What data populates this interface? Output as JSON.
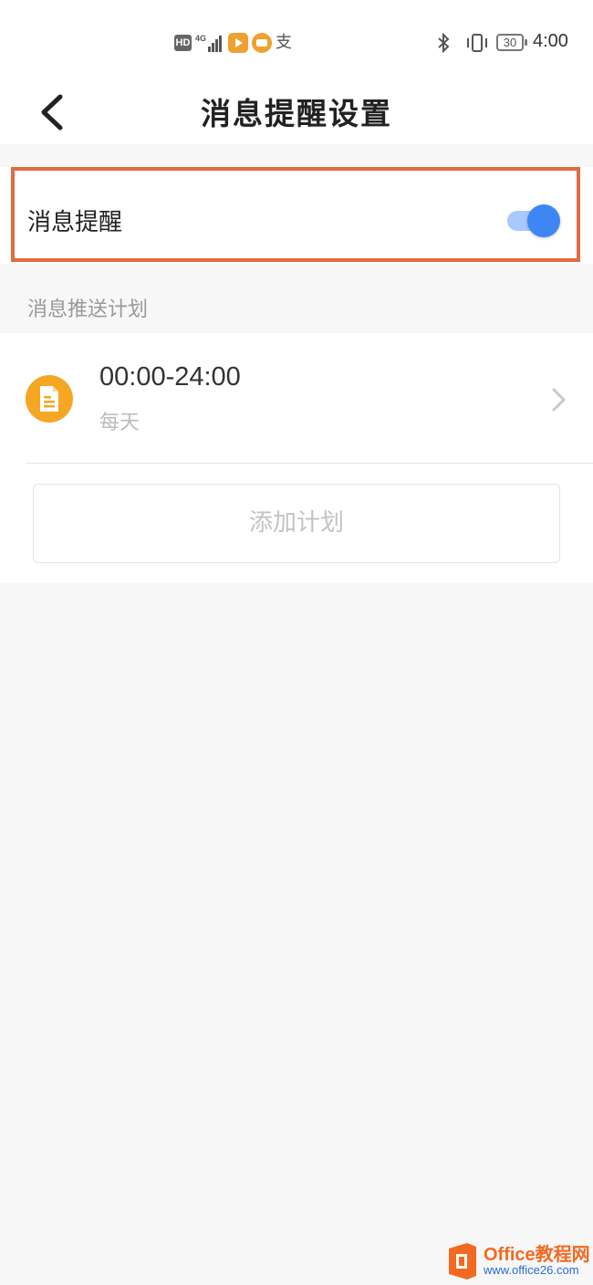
{
  "status_bar": {
    "hd_label": "HD",
    "network_label": "4G",
    "pay_glyph": "支",
    "battery_level": "30",
    "time": "4:00",
    "icons": [
      "hd-icon",
      "signal-icon",
      "video-app-icon",
      "news-app-icon",
      "alipay-icon",
      "bluetooth-icon",
      "vibrate-icon",
      "battery-icon"
    ]
  },
  "header": {
    "title": "消息提醒设置",
    "back_icon": "chevron-left-icon"
  },
  "message_reminder": {
    "label": "消息提醒",
    "enabled": true,
    "toggle_color": "#3d86f4",
    "highlight_color": "#e06b44"
  },
  "push_plan": {
    "section_title": "消息推送计划",
    "plans": [
      {
        "time_range": "00:00-24:00",
        "repeat": "每天",
        "icon": "document-icon",
        "icon_color": "#f5a623"
      }
    ],
    "add_button_label": "添加计划"
  },
  "watermark": {
    "title": "Office教程网",
    "url": "www.office26.com"
  }
}
